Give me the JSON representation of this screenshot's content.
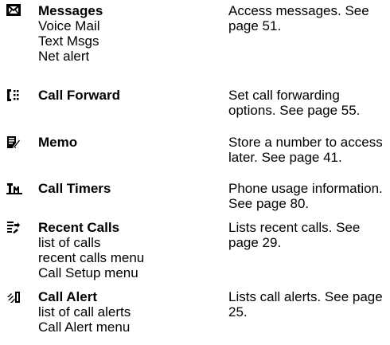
{
  "entries": [
    {
      "icon": "envelope-icon",
      "title": "Messages",
      "sub": [
        "Voice Mail",
        "Text Msgs",
        "Net alert"
      ],
      "desc": "Access messages. See page 51."
    },
    {
      "icon": "call-forward-icon",
      "title": "Call Forward",
      "sub": [],
      "desc": "Set call forwarding options. See page 55."
    },
    {
      "icon": "memo-icon",
      "title": "Memo",
      "sub": [],
      "desc": "Store a number to access later. See page 41."
    },
    {
      "icon": "call-timers-icon",
      "title": "Call Timers",
      "sub": [],
      "desc": "Phone usage information. See page 80."
    },
    {
      "icon": "recent-calls-icon",
      "title": "Recent Calls",
      "sub": [
        "list of calls",
        "recent calls menu",
        "Call Setup menu"
      ],
      "desc": "Lists recent calls. See page 29."
    },
    {
      "icon": "call-alert-icon",
      "title": "Call Alert",
      "sub": [
        "list of call alerts",
        "Call Alert menu"
      ],
      "desc": "Lists call alerts. See page 25."
    }
  ]
}
